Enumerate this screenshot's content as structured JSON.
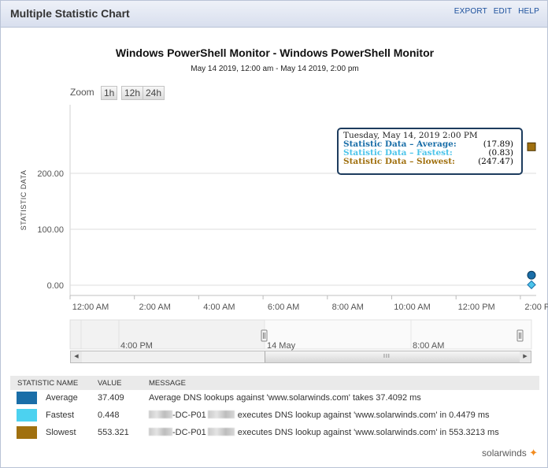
{
  "header": {
    "title": "Multiple Statistic Chart",
    "links": [
      "EXPORT",
      "EDIT",
      "HELP"
    ]
  },
  "chart_title": "Windows PowerShell Monitor - Windows PowerShell Monitor",
  "chart_subtitle": "May 14 2019, 12:00 am - May 14 2019, 2:00 pm",
  "zoom": {
    "label": "Zoom",
    "buttons": [
      "1h",
      "12h",
      "24h"
    ]
  },
  "tooltip": {
    "timestamp": "Tuesday, May 14, 2019 2:00 PM",
    "rows": [
      {
        "label": "Statistic Data – Average:",
        "value": "(17.89)",
        "color": "#1a6ea8"
      },
      {
        "label": "Statistic Data – Fastest:",
        "value": "(0.83)",
        "color": "#4cc4ea"
      },
      {
        "label": "Statistic Data – Slowest:",
        "value": "(247.47)",
        "color": "#a0700f"
      }
    ]
  },
  "chart_data": {
    "type": "scatter",
    "ylabel": "STATISTIC DATA",
    "y_ticks": [
      "0.00",
      "100.00",
      "200.00"
    ],
    "ylim": [
      0,
      300
    ],
    "x_ticks": [
      "12:00 AM",
      "2:00 AM",
      "4:00 AM",
      "6:00 AM",
      "8:00 AM",
      "10:00 AM",
      "12:00 PM",
      "2:00 PM"
    ],
    "grid": true,
    "series": [
      {
        "name": "Average",
        "x": [
          "2:00 PM"
        ],
        "values": [
          17.89
        ],
        "color": "#1a6ea8",
        "marker": "circle"
      },
      {
        "name": "Fastest",
        "x": [
          "2:00 PM"
        ],
        "values": [
          0.83
        ],
        "color": "#4cc4ea",
        "marker": "diamond"
      },
      {
        "name": "Slowest",
        "x": [
          "2:00 PM"
        ],
        "values": [
          247.47
        ],
        "color": "#a0700f",
        "marker": "square"
      }
    ]
  },
  "navigator": {
    "labels": [
      "4:00 PM",
      "14 May",
      "8:00 AM"
    ]
  },
  "table": {
    "headers": [
      "STATISTIC NAME",
      "VALUE",
      "MESSAGE"
    ],
    "rows": [
      {
        "name": "Average",
        "value": "37.409",
        "message_prefix": "",
        "message": "Average DNS lookups against 'www.solarwinds.com' takes 37.4092 ms",
        "color": "#1a6ea8"
      },
      {
        "name": "Fastest",
        "value": "0.448",
        "message_prefix": "-DC-P01",
        "message": "executes DNS lookup against 'www.solarwinds.com' in 0.4479 ms",
        "color": "#4cd2f0"
      },
      {
        "name": "Slowest",
        "value": "553.321",
        "message_prefix": "-DC-P01",
        "message": "executes DNS lookup against 'www.solarwinds.com' in 553.3213 ms",
        "color": "#a0700f"
      }
    ]
  },
  "logo": "solarwinds"
}
